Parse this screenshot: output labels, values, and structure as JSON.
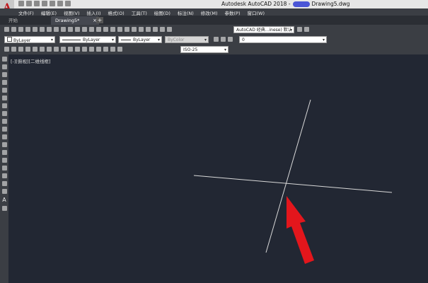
{
  "window": {
    "title_app": "Autodesk AutoCAD 2018 -",
    "title_file": "Drawing5.dwg"
  },
  "menu": [
    "文件(F)",
    "编辑(E)",
    "视图(V)",
    "插入(I)",
    "格式(O)",
    "工具(T)",
    "绘图(D)",
    "标注(N)",
    "修改(M)",
    "参数(P)",
    "窗口(W)"
  ],
  "tabs": {
    "start": "开始",
    "drawing": "Drawing5*",
    "close": "×",
    "add": "+"
  },
  "toolbar": {
    "workspace": "AutoCAD 经典...inese) 默认",
    "layer": "0",
    "color": "ByLayer",
    "linetype": "ByLayer",
    "lineweight": "ByLayer",
    "plotstyle": "ByColor",
    "dimstyle": "ISO-25"
  },
  "viewport": {
    "label": "[-][俯视][二维线框]"
  },
  "colors": {
    "canvas": "#222733",
    "annotation_arrow": "#e3161c",
    "crosshair": "#d9d9d9"
  }
}
